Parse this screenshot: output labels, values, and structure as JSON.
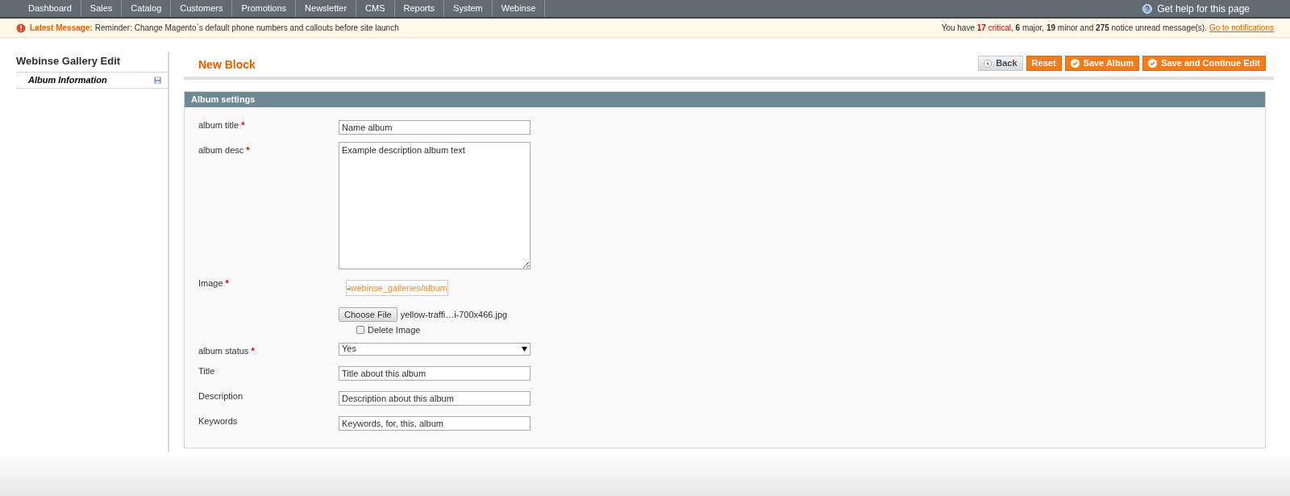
{
  "nav": {
    "items": [
      {
        "label": "Dashboard"
      },
      {
        "label": "Sales"
      },
      {
        "label": "Catalog"
      },
      {
        "label": "Customers"
      },
      {
        "label": "Promotions"
      },
      {
        "label": "Newsletter"
      },
      {
        "label": "CMS"
      },
      {
        "label": "Reports"
      },
      {
        "label": "System"
      },
      {
        "label": "Webinse"
      }
    ],
    "help": "Get help for this page"
  },
  "notice": {
    "label": "Latest Message:",
    "message": "Reminder: Change Magento`s default phone numbers and callouts before site launch",
    "summary": [
      {
        "text": "You have ",
        "kind": "plain"
      },
      {
        "text": "17",
        "kind": "critical-count"
      },
      {
        "text": " critical",
        "kind": "critical"
      },
      {
        "text": ", ",
        "kind": "plain"
      },
      {
        "text": "6",
        "kind": "count"
      },
      {
        "text": " major, ",
        "kind": "plain"
      },
      {
        "text": "19",
        "kind": "count"
      },
      {
        "text": " minor and ",
        "kind": "plain"
      },
      {
        "text": "275",
        "kind": "count"
      },
      {
        "text": " notice unread message(s).",
        "kind": "plain"
      }
    ],
    "link": "Go to notifications"
  },
  "sidebar": {
    "title": "Webinse Gallery Edit",
    "tabs": [
      {
        "label": "Album Information",
        "selected": true
      }
    ]
  },
  "page": {
    "title": "New Block",
    "buttons": [
      {
        "label": "Back",
        "kind": "back"
      },
      {
        "label": "Reset",
        "kind": "plain"
      },
      {
        "label": "Save Album",
        "kind": "save"
      },
      {
        "label": "Save and Continue Edit",
        "kind": "save"
      }
    ]
  },
  "fieldset": {
    "title": "Album settings",
    "fields": [
      {
        "kind": "text",
        "label": "album title",
        "required_mark": "*",
        "value": "Name album"
      },
      {
        "kind": "textarea",
        "label": "album desc",
        "required_mark": "*",
        "value": "Example description album text"
      },
      {
        "kind": "image",
        "label": "Image",
        "required_mark": "*",
        "preview_alt": "webinse_galleries/album",
        "button": "Choose File",
        "file": "yellow-traffi…i-700x466.jpg",
        "delete_label": "Delete Image",
        "delete_checked": false
      },
      {
        "kind": "select",
        "label": "album status",
        "required_mark": "*",
        "value": "Yes"
      },
      {
        "kind": "text",
        "label": "Title",
        "value": "Title about this album"
      },
      {
        "kind": "text",
        "label": "Description",
        "value": "Description about this album"
      },
      {
        "kind": "text",
        "label": "Keywords",
        "value": "Keywords, for, this, album"
      }
    ]
  }
}
